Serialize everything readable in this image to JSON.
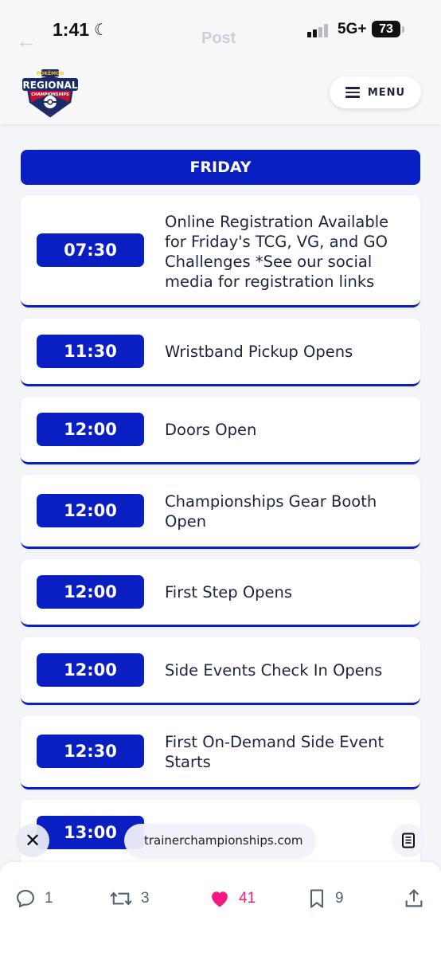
{
  "status_bar": {
    "time": "1:41",
    "network": "5G+",
    "battery": "73"
  },
  "background_header": {
    "title": "Post"
  },
  "site": {
    "logo_text_top": "POKÉMON",
    "logo_text_main": "REGIONAL",
    "logo_text_bottom": "CHAMPIONSHIPS",
    "menu_label": "MENU"
  },
  "schedule": {
    "day": "FRIDAY",
    "items": [
      {
        "time": "07:30",
        "event": "Online Registration Available for Friday's TCG, VG, and GO Challenges *See our social media for registration links"
      },
      {
        "time": "11:30",
        "event": "Wristband Pickup Opens"
      },
      {
        "time": "12:00",
        "event": "Doors Open"
      },
      {
        "time": "12:00",
        "event": "Championships Gear Booth Open"
      },
      {
        "time": "12:00",
        "event": "First Step Opens"
      },
      {
        "time": "12:00",
        "event": "Side Events Check In Opens"
      },
      {
        "time": "12:30",
        "event": "First On-Demand Side Event Starts"
      },
      {
        "time": "13:00",
        "event": ""
      }
    ]
  },
  "browser": {
    "url": "trainerchampionships.com"
  },
  "actions": {
    "replies": "1",
    "reposts": "3",
    "likes": "41",
    "bookmarks": "9"
  },
  "colors": {
    "accent": "#0a1fc2",
    "like": "#f91880",
    "text": "#1d2440"
  }
}
